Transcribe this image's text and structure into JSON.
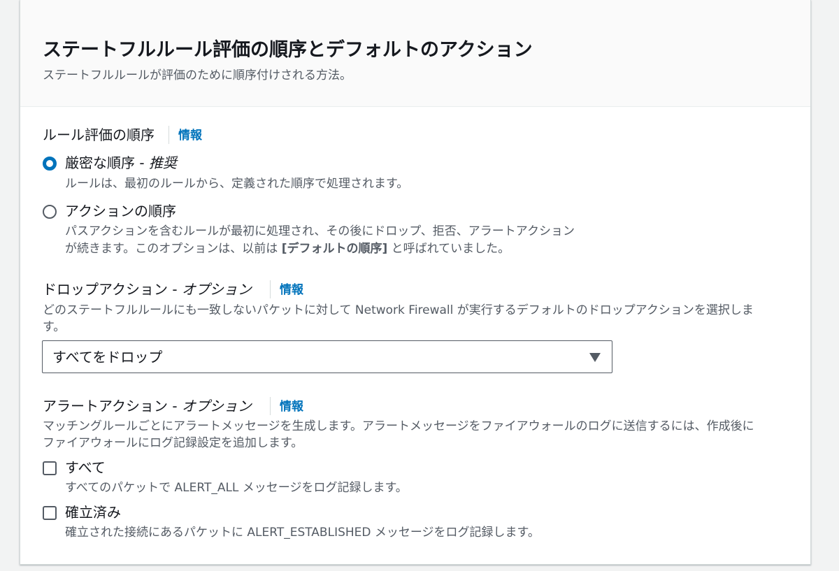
{
  "header": {
    "title": "ステートフルルール評価の順序とデフォルトのアクション",
    "description": "ステートフルルールが評価のために順序付けされる方法。"
  },
  "rule_order": {
    "label": "ルール評価の順序",
    "info": "情報",
    "options": [
      {
        "label": "厳密な順序 - ",
        "label_emphasis": "推奨",
        "description": "ルールは、最初のルールから、定義された順序で処理されます。",
        "selected": true
      },
      {
        "label": "アクションの順序",
        "description_line1": "パスアクションを含むルールが最初に処理され、その後にドロップ、拒否、アラートアクション",
        "description_line2_prefix": "が続きます。このオプションは、以前は",
        "description_line2_bold": "[デフォルトの順序]",
        "description_line2_suffix": "と呼ばれていました。",
        "selected": false
      }
    ]
  },
  "drop_action": {
    "label": "ドロップアクション - ",
    "label_emphasis": "オプション",
    "info": "情報",
    "description_line1": "どのステートフルルールにも一致しないパケットに対して Network Firewall が実行するデフォルトのドロップアクションを選択しま",
    "description_line2": "す。",
    "selected_value": "すべてをドロップ"
  },
  "alert_action": {
    "label": "アラートアクション - ",
    "label_emphasis": "オプション",
    "info": "情報",
    "description_line1": "マッチングルールごとにアラートメッセージを生成します。アラートメッセージをファイアウォールのログに送信するには、作成後に",
    "description_line2": "ファイアウォールにログ記録設定を追加します。",
    "options": [
      {
        "label": "すべて",
        "description": "すべてのパケットで ALERT_ALL メッセージをログ記録します。",
        "checked": false
      },
      {
        "label": "確立済み",
        "description": "確立された接続にあるパケットに ALERT_ESTABLISHED メッセージをログ記録します。",
        "checked": false
      }
    ]
  },
  "colors": {
    "accent": "#0073bb",
    "text": "#16191f",
    "secondary_text": "#545b64",
    "border": "#d5dbdb",
    "header_bg": "#fafafa"
  }
}
